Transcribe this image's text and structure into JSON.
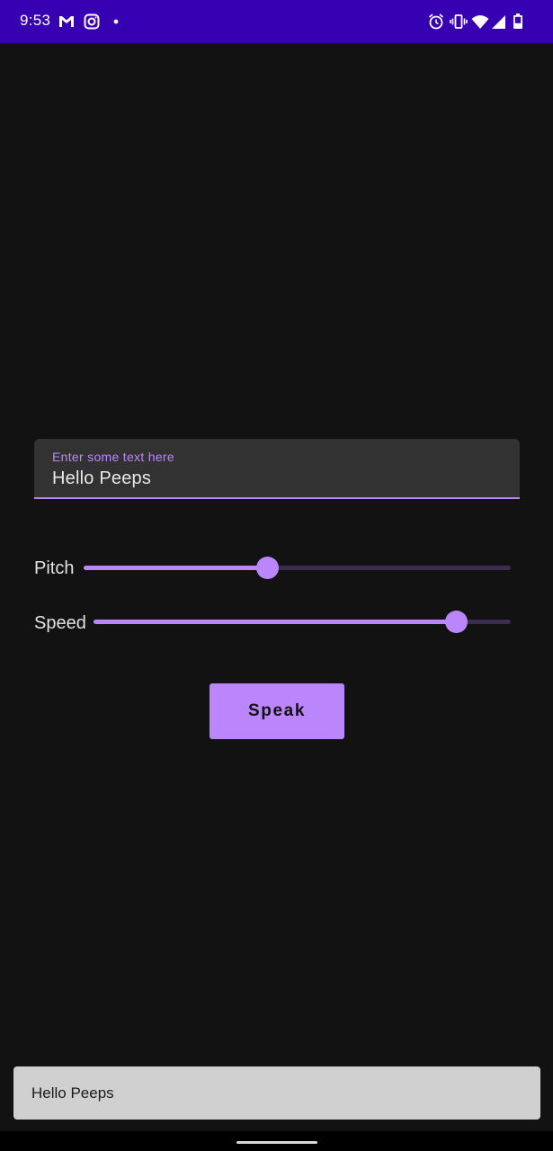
{
  "status_bar": {
    "time": "9:53",
    "background": "#3700b3",
    "left_icons": [
      "gmail-icon",
      "instagram-icon",
      "dot-icon"
    ],
    "right_icons": [
      "alarm-icon",
      "vibrate-icon",
      "wifi-icon",
      "cell-signal-icon",
      "battery-icon"
    ]
  },
  "text_field": {
    "label": "Enter some text here",
    "value": "Hello Peeps"
  },
  "pitch": {
    "label": "Pitch",
    "value_fraction": 0.43
  },
  "speed": {
    "label": "Speed",
    "value_fraction": 0.87
  },
  "speak_button": {
    "label": "Speak"
  },
  "toast": {
    "text": "Hello Peeps"
  },
  "colors": {
    "accent": "#bb86fc",
    "background": "#121212",
    "field_background": "#323232",
    "toast_background": "#d0d0d0"
  }
}
